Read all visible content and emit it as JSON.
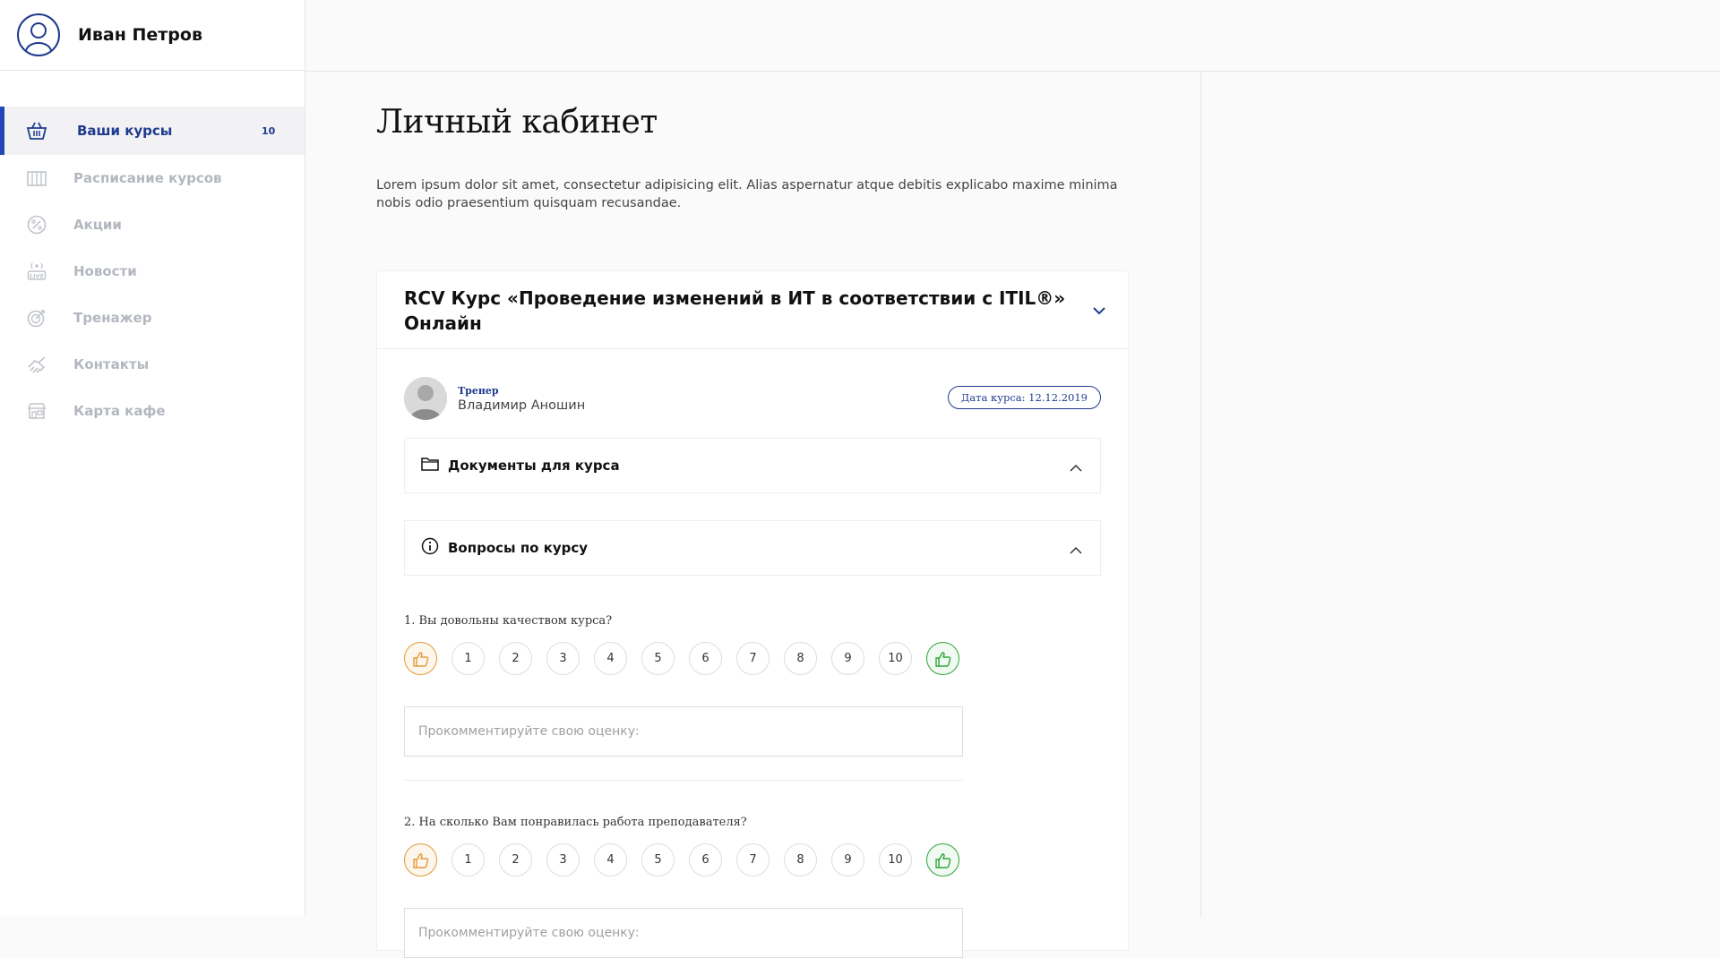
{
  "user": {
    "name": "Иван Петров"
  },
  "sidebar": {
    "items": [
      {
        "label": "Ваши курсы",
        "icon": "basket-icon",
        "count": "10"
      },
      {
        "label": "Расписание курсов",
        "icon": "schedule-icon"
      },
      {
        "label": "Акции",
        "icon": "percent-icon"
      },
      {
        "label": "Новости",
        "icon": "live-icon"
      },
      {
        "label": "Тренажер",
        "icon": "target-icon"
      },
      {
        "label": "Контакты",
        "icon": "handshake-icon"
      },
      {
        "label": "Карта кафе",
        "icon": "cafe-icon"
      }
    ]
  },
  "main": {
    "title": "Личный кабинет",
    "intro": "Lorem ipsum dolor sit amet, consectetur adipisicing elit. Alias aspernatur atque debitis explicabo maxime minima nobis odio praesentium quisquam recusandae."
  },
  "course": {
    "title": "RCV Курс «Проведение изменений в ИТ в соответствии с ITIL®» Онлайн",
    "trainer_role": "Тренер",
    "trainer_name": "Владимир Аношин",
    "date": "Дата курса: 12.12.2019",
    "documents_label": "Документы для курса",
    "questions_label": "Вопросы по курсу",
    "questions": [
      {
        "text": "1. Вы довольны качеством курса?",
        "comment_placeholder": "Прокомментируйте свою оценку:"
      },
      {
        "text": "2. На сколько Вам понравилась работа преподавателя?",
        "comment_placeholder": "Прокомментируйте свою оценку:"
      }
    ],
    "scale": [
      "1",
      "2",
      "3",
      "4",
      "5",
      "6",
      "7",
      "8",
      "9",
      "10"
    ]
  },
  "colors": {
    "accent": "#1f3b8f",
    "dislike": "#e39a3a",
    "like": "#2fa53a"
  }
}
